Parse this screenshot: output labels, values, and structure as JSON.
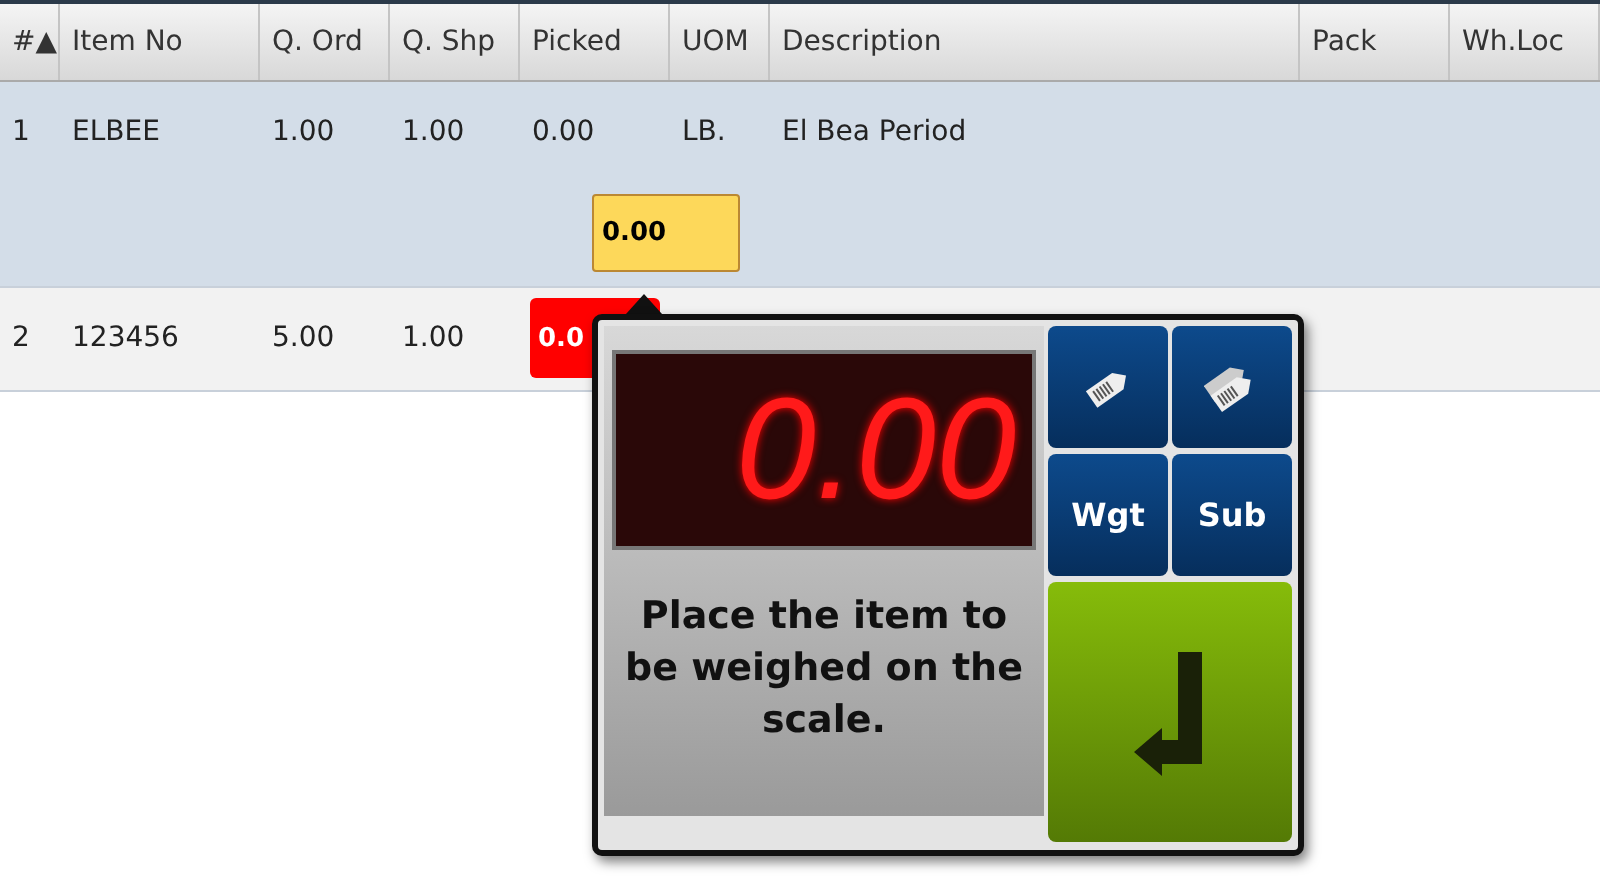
{
  "table": {
    "columns": [
      "#▲",
      "Item No",
      "Q. Ord",
      "Q. Shp",
      "Picked",
      "UOM",
      "Description",
      "Pack",
      "Wh.Loc"
    ],
    "rows": [
      {
        "selected": true,
        "cells": [
          "1",
          "ELBEE",
          "1.00",
          "1.00",
          "0.00",
          "LB.",
          "El Bea Period",
          "",
          ""
        ],
        "entry": {
          "kind": "current",
          "value": "0.00"
        }
      },
      {
        "selected": false,
        "cells": [
          "2",
          "123456",
          "5.00",
          "1.00",
          "",
          "",
          "",
          "",
          ""
        ],
        "entry": {
          "kind": "error",
          "value": "0.0"
        }
      }
    ]
  },
  "scale_popup": {
    "reading": "0.00",
    "message": "Place the item to be weighed on the scale.",
    "buttons": [
      {
        "kind": "tag"
      },
      {
        "kind": "tags"
      },
      {
        "kind": "text",
        "label": "Wgt"
      },
      {
        "kind": "text",
        "label": "Sub"
      }
    ],
    "confirm": {
      "kind": "enter"
    }
  }
}
